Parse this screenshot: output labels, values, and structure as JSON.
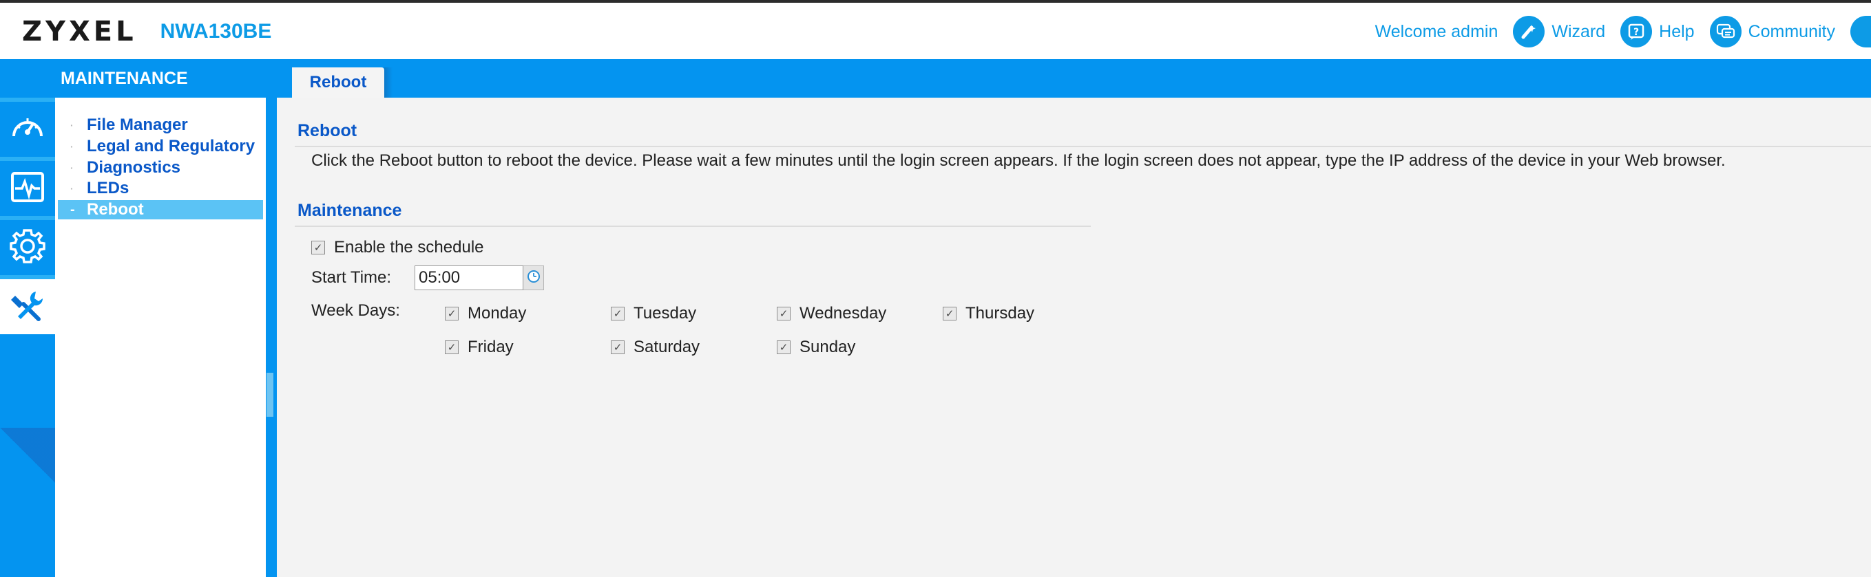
{
  "header": {
    "logo": "ZYXEL",
    "model": "NWA130BE",
    "welcome": "Welcome admin",
    "wizard_label": "Wizard",
    "help_label": "Help",
    "community_label": "Community"
  },
  "section_title": "MAINTENANCE",
  "rail_icons": [
    "dashboard-icon",
    "monitor-icon",
    "configuration-icon",
    "maintenance-icon"
  ],
  "sidebar": {
    "items": [
      {
        "label": "File Manager",
        "selected": false
      },
      {
        "label": "Legal and Regulatory",
        "selected": false
      },
      {
        "label": "Diagnostics",
        "selected": false
      },
      {
        "label": "LEDs",
        "selected": false
      },
      {
        "label": "Reboot",
        "selected": true
      }
    ]
  },
  "tab": {
    "label": "Reboot"
  },
  "reboot": {
    "heading": "Reboot",
    "description": "Click the Reboot button to reboot the device. Please wait a few minutes until the login screen appears. If the login screen does not appear, type the IP address of the device in your Web browser."
  },
  "maintenance": {
    "heading": "Maintenance",
    "enable_schedule_label": "Enable the schedule",
    "enable_schedule_checked": true,
    "start_time_label": "Start Time:",
    "start_time_value": "05:00",
    "week_days_label": "Week Days:",
    "days": [
      {
        "label": "Monday",
        "checked": true
      },
      {
        "label": "Tuesday",
        "checked": true
      },
      {
        "label": "Wednesday",
        "checked": true
      },
      {
        "label": "Thursday",
        "checked": true
      },
      {
        "label": "Friday",
        "checked": true
      },
      {
        "label": "Saturday",
        "checked": true
      },
      {
        "label": "Sunday",
        "checked": true
      }
    ]
  },
  "colors": {
    "accent": "#0494f0",
    "link": "#0a58c8",
    "header_text": "#0d9be6",
    "selected_bg": "#5bc3f5"
  }
}
